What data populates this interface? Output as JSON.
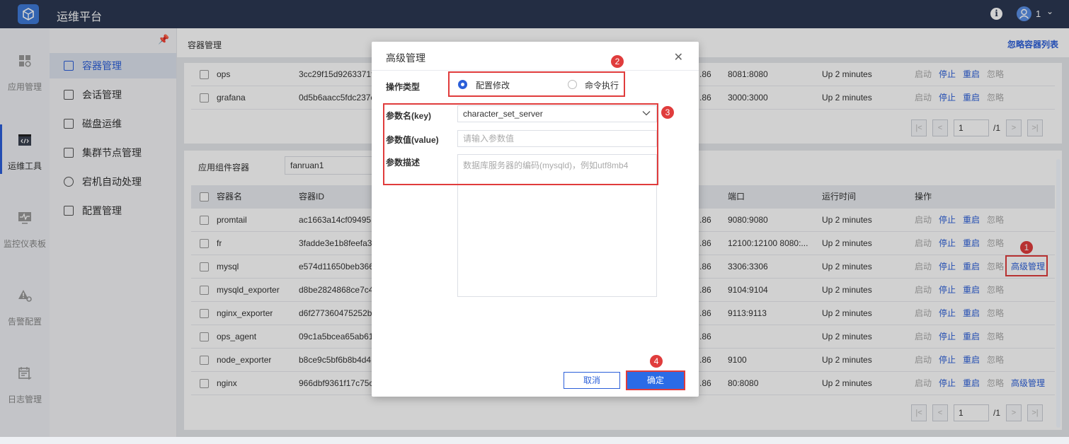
{
  "app": {
    "title": "运维平台",
    "user_label": "1"
  },
  "rail": [
    {
      "label": "应用管理",
      "icon": "grid-icon"
    },
    {
      "label": "运维工具",
      "icon": "code-window-icon",
      "active": true
    },
    {
      "label": "监控仪表板",
      "icon": "monitor-icon"
    },
    {
      "label": "告警配置",
      "icon": "alert-gear-icon"
    },
    {
      "label": "日志管理",
      "icon": "calendar-log-icon"
    }
  ],
  "subnav": [
    {
      "label": "容器管理",
      "active": true
    },
    {
      "label": "会话管理"
    },
    {
      "label": "磁盘运维"
    },
    {
      "label": "集群节点管理"
    },
    {
      "label": "宕机自动处理"
    },
    {
      "label": "配置管理"
    }
  ],
  "header": {
    "title": "容器管理",
    "ignore_list_link": "忽略容器列表"
  },
  "top_table": {
    "rows": [
      {
        "name": "ops",
        "id": "3cc29f15d9263371f",
        "ip": ".86",
        "port": "8081:8080",
        "uptime": "Up 2 minutes"
      },
      {
        "name": "grafana",
        "id": "0d5b6aacc5fdc237c",
        "ip": ".86",
        "port": "3000:3000",
        "uptime": "Up 2 minutes"
      }
    ],
    "ops": {
      "start": "启动",
      "stop": "停止",
      "restart": "重启",
      "ignore": "忽略"
    },
    "pager": {
      "page": "1",
      "total": "/1"
    }
  },
  "component": {
    "filter_label": "应用组件容器",
    "filter_value": "fanruan1",
    "columns": {
      "name": "容器名",
      "id": "容器ID",
      "port": "端口",
      "uptime": "运行时间",
      "ops": "操作"
    },
    "rows": [
      {
        "name": "promtail",
        "id": "ac1663a14cf09495",
        "ip": ".86",
        "port": "9080:9080",
        "uptime": "Up 2 minutes",
        "advanced": ""
      },
      {
        "name": "fr",
        "id": "3fadde3e1b8feefa3",
        "ip": ".86",
        "port": "12100:12100 8080:...",
        "uptime": "Up 2 minutes",
        "advanced": ""
      },
      {
        "name": "mysql",
        "id": "e574d11650beb366",
        "ip": ".86",
        "port": "3306:3306",
        "uptime": "Up 2 minutes",
        "advanced": "高级管理"
      },
      {
        "name": "mysqld_exporter",
        "id": "d8be2824868ce7c4",
        "ip": ".86",
        "port": "9104:9104",
        "uptime": "Up 2 minutes",
        "advanced": ""
      },
      {
        "name": "nginx_exporter",
        "id": "d6f277360475252b",
        "ip": ".86",
        "port": "9113:9113",
        "uptime": "Up 2 minutes",
        "advanced": ""
      },
      {
        "name": "ops_agent",
        "id": "09c1a5bcea65ab61",
        "ip": ".86",
        "port": "",
        "uptime": "Up 2 minutes",
        "advanced": ""
      },
      {
        "name": "node_exporter",
        "id": "b8ce9c5bf6b8b4d4",
        "ip": ".86",
        "port": "9100",
        "uptime": "Up 2 minutes",
        "advanced": ""
      },
      {
        "name": "nginx",
        "id": "966dbf9361f17c75c",
        "ip": ".86",
        "port": "80:8080",
        "uptime": "Up 2 minutes",
        "advanced": "高级管理"
      }
    ],
    "ops": {
      "start": "启动",
      "stop": "停止",
      "restart": "重启",
      "ignore": "忽略"
    },
    "pager": {
      "page": "1",
      "total": "/1"
    }
  },
  "dialog": {
    "title": "高级管理",
    "op_type_label": "操作类型",
    "op_config": "配置修改",
    "op_command": "命令执行",
    "key_label": "参数名(key)",
    "key_value": "character_set_server",
    "value_label": "参数值(value)",
    "value_placeholder": "请输入参数值",
    "desc_label": "参数描述",
    "desc_placeholder": "数据库服务器的编码(mysqld)，例如utf8mb4",
    "cancel": "取消",
    "confirm": "确定"
  },
  "badges": {
    "b1": "1",
    "b2": "2",
    "b3": "3",
    "b4": "4"
  },
  "colors": {
    "topbar": "#2b3852",
    "accent": "#2b5fd9",
    "annotation": "#e03c3c"
  }
}
